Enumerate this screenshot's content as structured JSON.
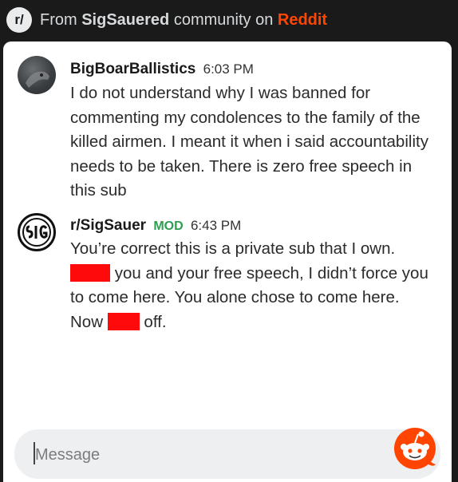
{
  "header": {
    "badge": "r/",
    "prefix": "From ",
    "community": "SigSauered",
    "middle": " community on ",
    "brand": "Reddit"
  },
  "messages": [
    {
      "author": "BigBoarBallistics",
      "time": "6:03 PM",
      "text": "I do not understand why I was banned for commenting my condolences to the family of the killed airmen. I meant it when i said accountability needs to be taken. There is zero free speech in this sub"
    },
    {
      "author": "r/SigSauer",
      "badge": "MOD",
      "time": "6:43 PM",
      "text_1": "You’re correct this is a private sub that I own. ",
      "text_2": " you and your free speech, I didn’t force you to come here. You alone chose to come here. Now ",
      "text_3": " off."
    }
  ],
  "composer": {
    "placeholder": "Message"
  },
  "colors": {
    "brand": "#ff4500",
    "mod": "#2e9e4f",
    "redaction": "#ff0a0a"
  },
  "icons": [
    "reddit-badge-icon",
    "user-avatar-icon",
    "sig-logo-icon",
    "snoo-icon"
  ]
}
